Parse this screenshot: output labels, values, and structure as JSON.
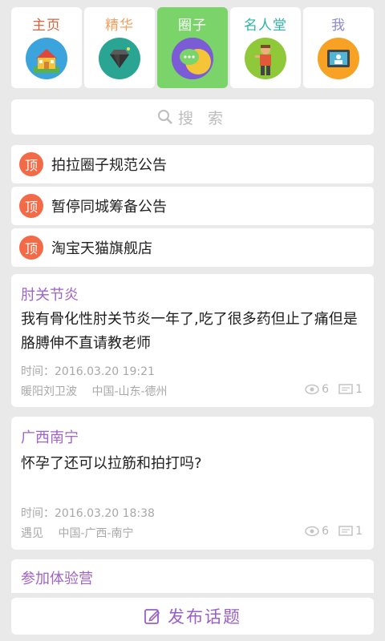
{
  "tabs": [
    {
      "label": "主页",
      "color": "#e0603c",
      "icon": "house-icon"
    },
    {
      "label": "精华",
      "color": "#f3a160",
      "icon": "diamond-icon"
    },
    {
      "label": "圈子",
      "color": "#ffffff",
      "icon": "chat-bubble-icon",
      "active": true
    },
    {
      "label": "名人堂",
      "color": "#2cb5a4",
      "icon": "person-icon"
    },
    {
      "label": "我",
      "color": "#8b8ad0",
      "icon": "monitor-profile-icon"
    }
  ],
  "search": {
    "placeholder": "搜 索"
  },
  "pinned": [
    {
      "badge": "顶",
      "title": "拍拉圈子规范公告"
    },
    {
      "badge": "顶",
      "title": "暂停同城筹备公告"
    },
    {
      "badge": "顶",
      "title": "淘宝天猫旗舰店"
    }
  ],
  "posts": [
    {
      "tag": "肘关节炎",
      "body": "我有骨化性肘关节炎一年了,吃了很多药但止了痛但是胳膊伸不直请教老师",
      "time": "时间：2016.03.20 19:21",
      "author": "暖阳刘卫波",
      "location": "中国-山东-德州",
      "views": "6",
      "comments": "1"
    },
    {
      "tag": "广西南宁",
      "body": "怀孕了还可以拉筋和拍打吗?",
      "time": "时间：2016.03.20 18:38",
      "author": "遇见",
      "location": "中国-广西-南宁",
      "views": "6",
      "comments": "1"
    },
    {
      "tag": "参加体验营"
    }
  ],
  "publish": {
    "label": "发布话题"
  }
}
